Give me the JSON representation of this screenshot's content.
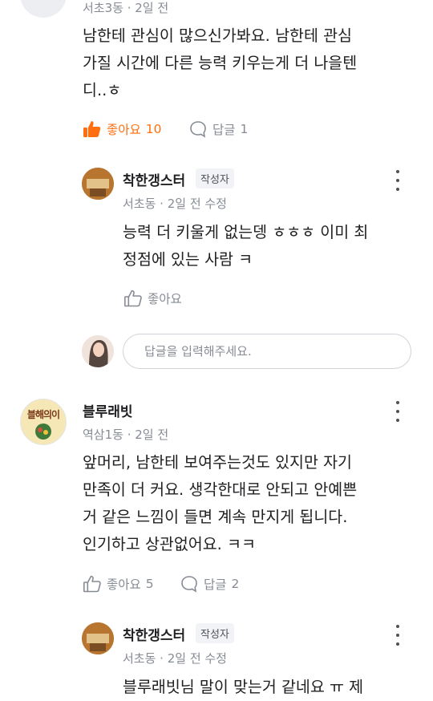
{
  "colors": {
    "accent": "#ff6f0f",
    "gray": "#868b94",
    "text": "#212124"
  },
  "comment1": {
    "meta": "서초3동 · 2일 전",
    "lines": [
      "남한테 관심이 많으신가봐요. 남한테 관심",
      "가질 시간에 다른 능력 키우는게 더 나을텐",
      "디..ㅎ"
    ],
    "like_label": "좋아요",
    "like_count": "10",
    "reply_label": "답글",
    "reply_count": "1"
  },
  "reply1": {
    "name": "착한갱스터",
    "badge": "작성자",
    "meta": "서초동 · 2일 전 수정",
    "lines": [
      "능력 더 키울게 없는뎅 ㅎㅎㅎ 이미 최",
      "정점에 있는 사람 ㅋ"
    ],
    "like_label": "좋아요"
  },
  "reply_input": {
    "placeholder": "답글을 입력해주세요."
  },
  "comment2": {
    "name": "블루래빗",
    "avatar_text": "블해의이",
    "meta": "역삼1동 · 2일 전",
    "lines": [
      "앞머리, 남한테 보여주는것도 있지만 자기",
      "만족이 더 커요. 생각한대로 안되고 안예쁜",
      "거 같은 느낌이 들면 계속 만지게 됩니다.",
      "인기하고 상관없어요. ㅋㅋ"
    ],
    "like_label": "좋아요",
    "like_count": "5",
    "reply_label": "답글",
    "reply_count": "2"
  },
  "reply2": {
    "name": "착한갱스터",
    "badge": "작성자",
    "meta": "서초동 · 2일 전 수정",
    "lines": [
      "블루래빗님 말이 맞는거 같네요 ㅠ 제"
    ]
  }
}
